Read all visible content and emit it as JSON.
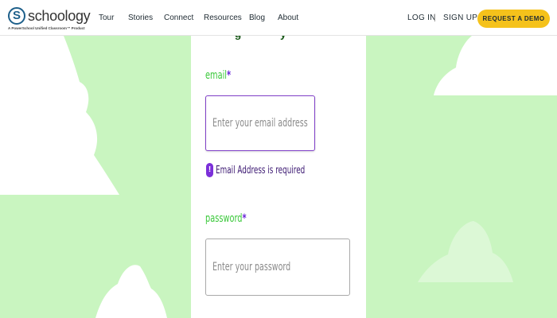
{
  "brand": {
    "logo_letter": "S",
    "name": "schoology",
    "tagline": "A PowerSchool Unified Classroom™ Product",
    "accent_color": "#f5c21b",
    "background_color": "#c9f5c0"
  },
  "nav": {
    "links": [
      "Tour",
      "Stories",
      "Connect",
      "Resources",
      "Blog",
      "About"
    ],
    "login": "LOG IN",
    "separator": "|",
    "signup": "SIGN UP",
    "cta": "REQUEST A DEMO"
  },
  "form": {
    "heading_fragment": "• g • y",
    "email": {
      "label": "email",
      "required_marker": "*",
      "placeholder": "Enter your email address",
      "value": "",
      "error": "Email Address is required",
      "error_icon": "exclamation-icon"
    },
    "password": {
      "label": "password",
      "required_marker": "*",
      "placeholder": "Enter your password",
      "value": ""
    }
  }
}
